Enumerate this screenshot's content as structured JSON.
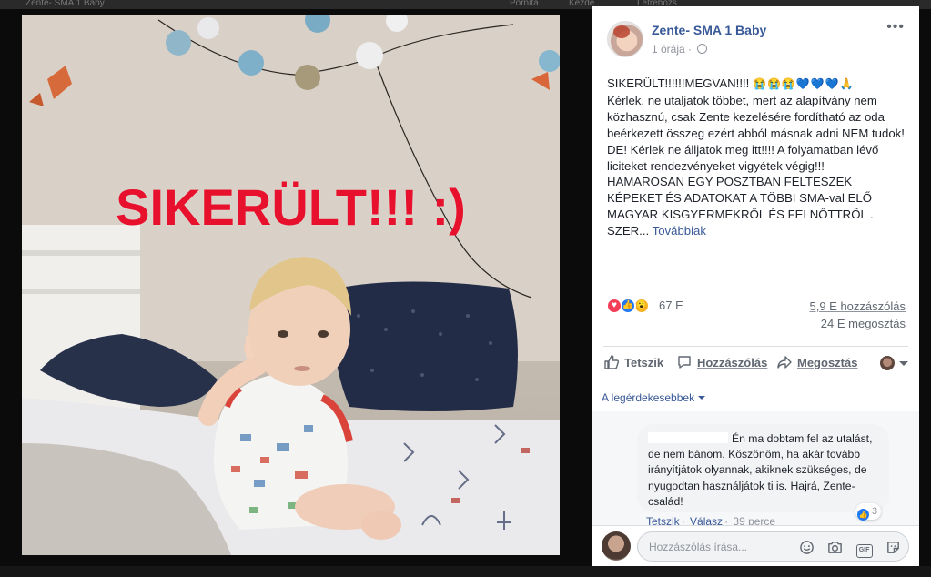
{
  "background": {
    "strip_texts": [
      "Zente- SMA 1 Baby",
      "Pornita",
      "Kezde...",
      "Létrehozs"
    ]
  },
  "photo": {
    "caption": "SIKERÜLT!!! :)",
    "caption_color": "#e8112d"
  },
  "post": {
    "author": "Zente- SMA 1 Baby",
    "time": "1 órája",
    "privacy_icon": "globe-icon",
    "more_icon": "more-options-icon",
    "text_first_line": "SIKERÜLT!!!!!!MEGVAN!!!! ",
    "emojis": "😭😭😭💙💙💙🙏",
    "text_body": "Kérlek, ne utaljatok többet, mert az alapítvány nem közhasznú, csak Zente kezelésére fordítható az oda beérkezett összeg ezért abból másnak adni NEM tudok!\nDE! Kérlek ne álljatok meg itt!!!! A folyamatban lévő liciteket rendezvényeket vigyétek végig!!!\nHAMAROSAN EGY POSZTBAN FELTESZEK KÉPEKET ÉS ADATOKAT A TÖBBI SMA-val ELŐ MAGYAR KISGYERMEKRŐL ÉS FELNŐTTRŐL . SZER...",
    "see_more": "Továbbiak",
    "reaction_count": "67 E",
    "comments_count": "5,9 E hozzászólás",
    "shares_count": "24 E megosztás",
    "accent": "#385898"
  },
  "actions": {
    "like": "Tetszik",
    "comment": "Hozzászólás",
    "share": "Megosztás"
  },
  "comments": {
    "sort_label": "A legérdekesebbek",
    "items": [
      {
        "text": "Én ma dobtam fel az utalást, de nem bánom. Köszönöm, ha akár tovább irányítjátok olyannak, akiknek szükséges, de nyugodtan használjátok ti is. Hajrá, Zente-család!",
        "likes": "3",
        "like_action": "Tetszik",
        "reply_action": "Válasz",
        "time": "39 perce"
      }
    ]
  },
  "compose": {
    "placeholder": "Hozzászólás írása...",
    "icons": [
      "emoji-icon",
      "camera-icon",
      "gif-icon",
      "sticker-icon"
    ]
  }
}
